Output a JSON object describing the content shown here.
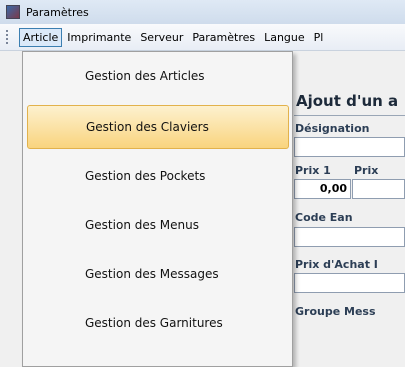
{
  "window": {
    "title": "Paramètres"
  },
  "menubar": {
    "items": [
      "Article",
      "Imprimante",
      "Serveur",
      "Paramètres",
      "Langue",
      "Pl"
    ]
  },
  "dropdown": {
    "items": [
      "Gestion des Articles",
      "Gestion des Claviers",
      "Gestion des Pockets",
      "Gestion des Menus",
      "Gestion des Messages",
      "Gestion des Garnitures"
    ],
    "highlighted_index": 1
  },
  "form": {
    "title": "Ajout d'un a",
    "designation_label": "Désignation",
    "prix1_label": "Prix 1",
    "prix2_label": "Prix",
    "prix1_value": "0,00",
    "code_ean_label": "Code Ean",
    "prix_achat_label": "Prix d'Achat I",
    "groupe_label": "Groupe Mess"
  },
  "colors": {
    "highlight_top": "#fdf1cf",
    "highlight_bottom": "#f9d47e",
    "active_menu_border": "#3c7fb1"
  }
}
